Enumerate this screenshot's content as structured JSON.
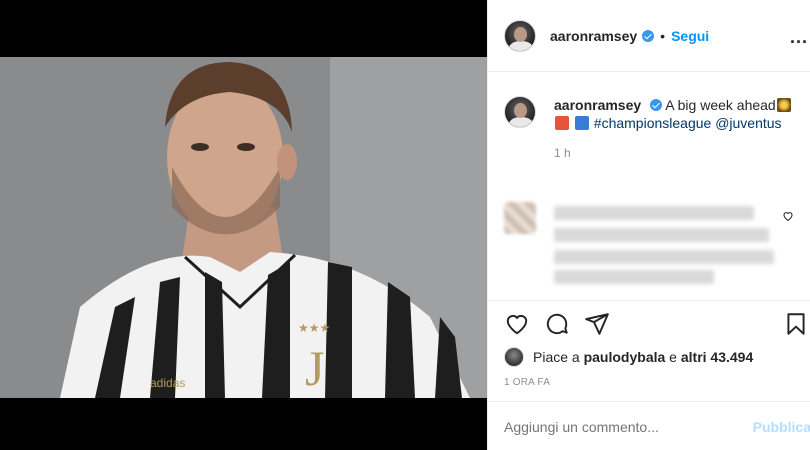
{
  "post": {
    "username": "aaronramsey",
    "follow_label": "Segui",
    "dot": "•",
    "more_label": "...",
    "caption": {
      "username": "aaronramsey",
      "text_before": "A big week ahead",
      "hashtag": "#championsleague",
      "mention": "@juventus"
    },
    "caption_time": "1 h",
    "likes": {
      "prefix": "Piace a ",
      "liker": "paulodybala",
      "middle": " e ",
      "others": "altri 43.494"
    },
    "date": "1 ORA FA",
    "comment_input": {
      "placeholder": "Aggiungi un commento..."
    },
    "publish_label": "Pubblica"
  },
  "colors": {
    "link_blue": "#0095f6",
    "verified_blue": "#3897f0",
    "hashtag": "#00376b",
    "muted": "#8e8e8e",
    "publish_disabled": "#b2dffc"
  },
  "icons": {
    "like": "heart-icon",
    "comment": "comment-icon",
    "share": "share-icon",
    "save": "bookmark-icon",
    "more": "more-options-icon"
  }
}
